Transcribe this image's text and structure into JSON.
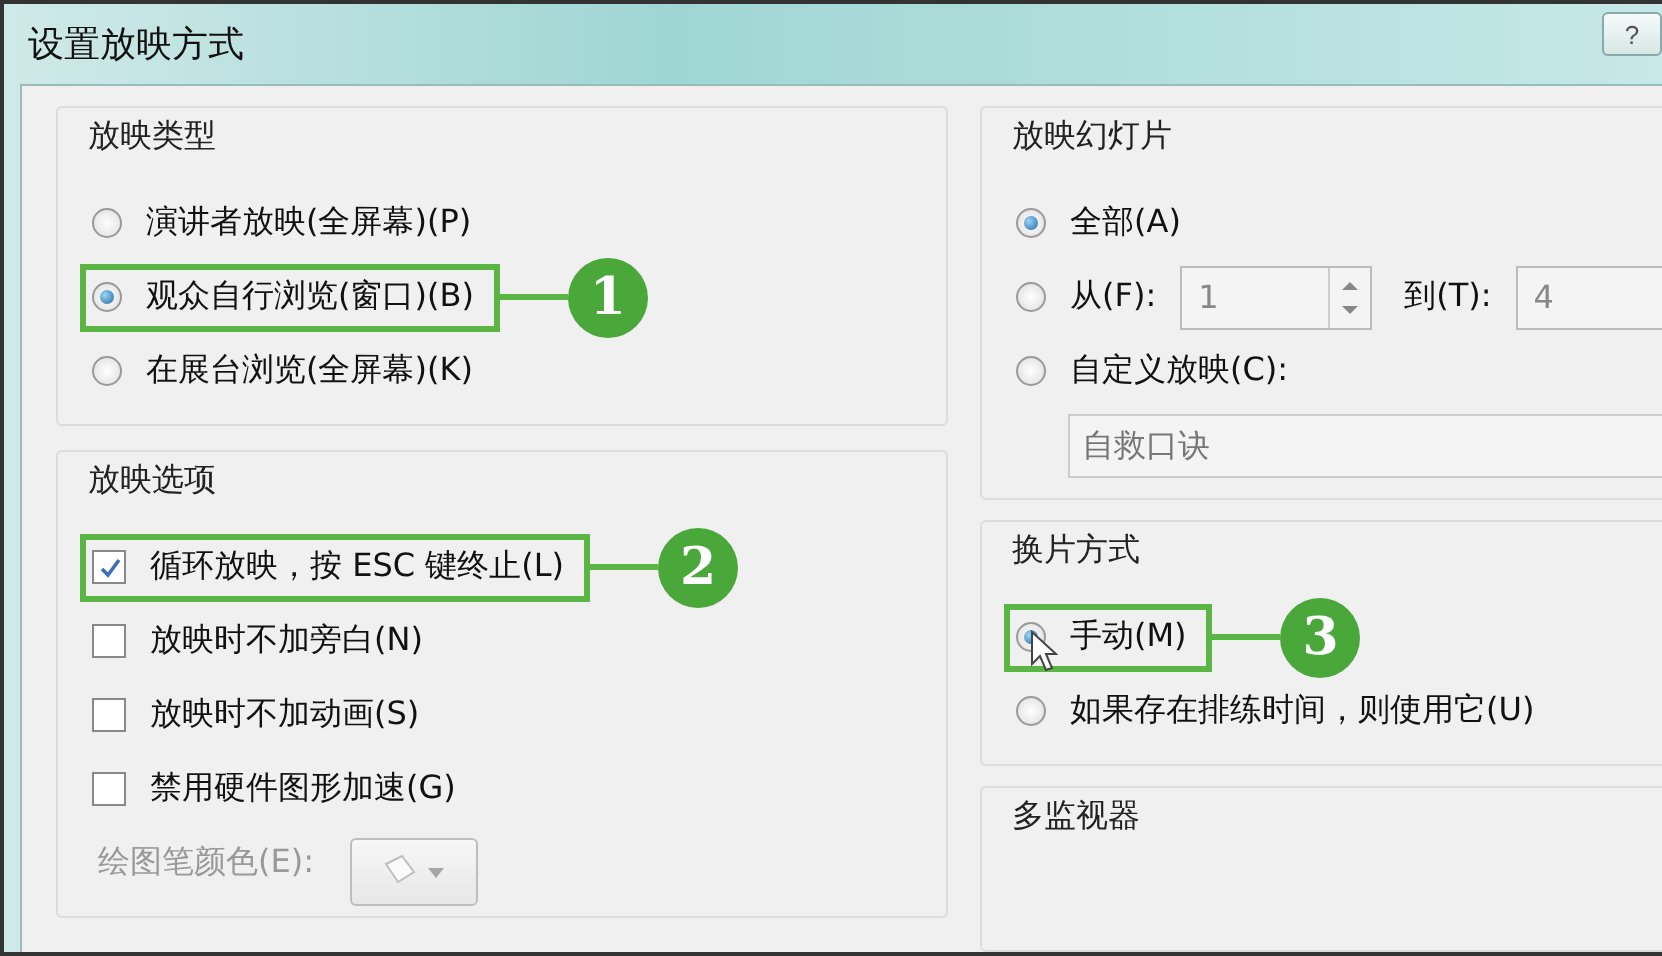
{
  "window": {
    "title": "设置放映方式",
    "help_button": "?"
  },
  "show_type": {
    "title": "放映类型",
    "options": [
      {
        "label": "演讲者放映(全屏幕)(P)",
        "selected": false
      },
      {
        "label": "观众自行浏览(窗口)(B)",
        "selected": true,
        "callout": "1"
      },
      {
        "label": "在展台浏览(全屏幕)(K)",
        "selected": false
      }
    ]
  },
  "show_options": {
    "title": "放映选项",
    "options": [
      {
        "label": "循环放映，按 ESC 键终止(L)",
        "checked": true,
        "callout": "2"
      },
      {
        "label": "放映时不加旁白(N)",
        "checked": false
      },
      {
        "label": "放映时不加动画(S)",
        "checked": false
      },
      {
        "label": "禁用硬件图形加速(G)",
        "checked": false
      }
    ],
    "pen_color": {
      "label": "绘图笔颜色(E):",
      "disabled": true
    }
  },
  "slides": {
    "title": "放映幻灯片",
    "options": [
      {
        "kind": "all",
        "label": "全部(A)",
        "selected": true
      },
      {
        "kind": "range",
        "label": "从(F):",
        "selected": false,
        "from": "1",
        "to_label": "到(T):",
        "to": "4"
      },
      {
        "kind": "custom",
        "label": "自定义放映(C):",
        "selected": false,
        "value": "自救口诀"
      }
    ]
  },
  "advance": {
    "title": "换片方式",
    "options": [
      {
        "label": "手动(M)",
        "selected": true,
        "callout": "3",
        "pointer": true
      },
      {
        "label": "如果存在排练时间，则使用它(U)",
        "selected": false
      }
    ]
  },
  "monitors": {
    "title": "多监视器"
  }
}
